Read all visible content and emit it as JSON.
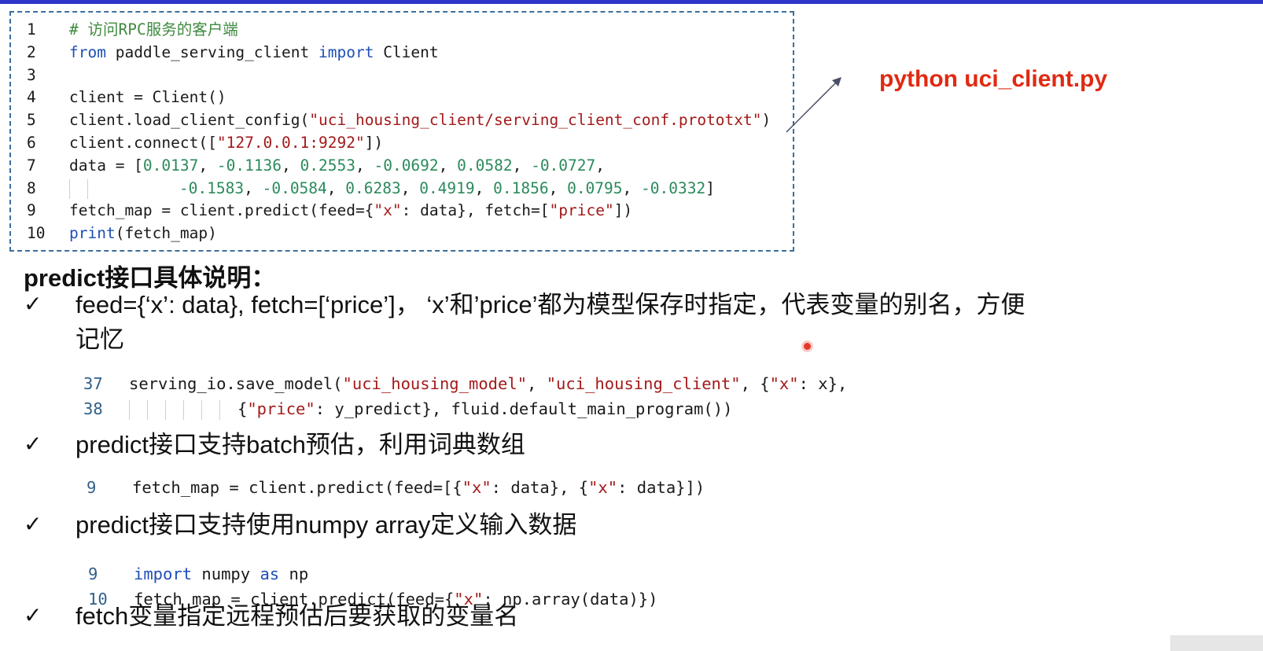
{
  "code_block": {
    "lines": [
      {
        "n": "1",
        "parts": [
          {
            "t": "# 访问RPC服务的客户端",
            "c": "com"
          }
        ]
      },
      {
        "n": "2",
        "parts": [
          {
            "t": "from",
            "c": "kw"
          },
          {
            "t": " paddle_serving_client ",
            "c": ""
          },
          {
            "t": "import",
            "c": "kw"
          },
          {
            "t": " Client",
            "c": ""
          }
        ]
      },
      {
        "n": "3",
        "parts": []
      },
      {
        "n": "4",
        "parts": [
          {
            "t": "client = Client()",
            "c": ""
          }
        ]
      },
      {
        "n": "5",
        "parts": [
          {
            "t": "client.load_client_config(",
            "c": ""
          },
          {
            "t": "\"uci_housing_client/serving_client_conf.prototxt\"",
            "c": "str"
          },
          {
            "t": ")",
            "c": ""
          }
        ]
      },
      {
        "n": "6",
        "parts": [
          {
            "t": "client.connect([",
            "c": ""
          },
          {
            "t": "\"127.0.0.1:9292\"",
            "c": "str"
          },
          {
            "t": "])",
            "c": ""
          }
        ]
      },
      {
        "n": "7",
        "parts": [
          {
            "t": "data = [",
            "c": ""
          },
          {
            "t": "0.0137",
            "c": "num"
          },
          {
            "t": ", ",
            "c": ""
          },
          {
            "t": "-0.1136",
            "c": "num"
          },
          {
            "t": ", ",
            "c": ""
          },
          {
            "t": "0.2553",
            "c": "num"
          },
          {
            "t": ", ",
            "c": ""
          },
          {
            "t": "-0.0692",
            "c": "num"
          },
          {
            "t": ", ",
            "c": ""
          },
          {
            "t": "0.0582",
            "c": "num"
          },
          {
            "t": ", ",
            "c": ""
          },
          {
            "t": "-0.0727",
            "c": "num"
          },
          {
            "t": ",",
            "c": ""
          }
        ]
      },
      {
        "n": "8",
        "guides": 2,
        "parts": [
          {
            "t": "        ",
            "c": ""
          },
          {
            "t": "-0.1583",
            "c": "num"
          },
          {
            "t": ", ",
            "c": ""
          },
          {
            "t": "-0.0584",
            "c": "num"
          },
          {
            "t": ", ",
            "c": ""
          },
          {
            "t": "0.6283",
            "c": "num"
          },
          {
            "t": ", ",
            "c": ""
          },
          {
            "t": "0.4919",
            "c": "num"
          },
          {
            "t": ", ",
            "c": ""
          },
          {
            "t": "0.1856",
            "c": "num"
          },
          {
            "t": ", ",
            "c": ""
          },
          {
            "t": "0.0795",
            "c": "num"
          },
          {
            "t": ", ",
            "c": ""
          },
          {
            "t": "-0.0332",
            "c": "num"
          },
          {
            "t": "]",
            "c": ""
          }
        ]
      },
      {
        "n": "9",
        "parts": [
          {
            "t": "fetch_map = client.predict(feed={",
            "c": ""
          },
          {
            "t": "\"x\"",
            "c": "str"
          },
          {
            "t": ": data}, fetch=[",
            "c": ""
          },
          {
            "t": "\"price\"",
            "c": "str"
          },
          {
            "t": "])",
            "c": ""
          }
        ]
      },
      {
        "n": "10",
        "parts": [
          {
            "t": "print",
            "c": "kw"
          },
          {
            "t": "(fetch_map)",
            "c": ""
          }
        ]
      }
    ]
  },
  "command": "python uci_client.py",
  "heading": "predict接口具体说明：",
  "check_glyph": "✓",
  "bullets": [
    {
      "line1": "feed={‘x’: data}, fetch=[‘price’]， ‘x’和’price’都为模型保存时指定，代表变量的别名，方便",
      "line2": "记忆"
    },
    {
      "line1": "predict接口支持batch预估，利用词典数组"
    },
    {
      "line1": "predict接口支持使用numpy array定义输入数据"
    },
    {
      "line1": "fetch变量指定远程预估后要获取的变量名"
    }
  ],
  "snippets": {
    "save_model": [
      {
        "n": "37",
        "parts": [
          {
            "t": "serving_io.save_model(",
            "c": ""
          },
          {
            "t": "\"uci_housing_model\"",
            "c": "str"
          },
          {
            "t": ", ",
            "c": ""
          },
          {
            "t": "\"uci_housing_client\"",
            "c": "str"
          },
          {
            "t": ", {",
            "c": ""
          },
          {
            "t": "\"x\"",
            "c": "str"
          },
          {
            "t": ": x},",
            "c": ""
          }
        ]
      },
      {
        "n": "38",
        "guides": 6,
        "parts": [
          {
            "t": "{",
            "c": ""
          },
          {
            "t": "\"price\"",
            "c": "str"
          },
          {
            "t": ": y_predict}, fluid.default_main_program())",
            "c": ""
          }
        ]
      }
    ],
    "batch": [
      {
        "n": "9",
        "parts": [
          {
            "t": "fetch_map = client.predict(feed=[{",
            "c": ""
          },
          {
            "t": "\"x\"",
            "c": "str"
          },
          {
            "t": ": data}, {",
            "c": ""
          },
          {
            "t": "\"x\"",
            "c": "str"
          },
          {
            "t": ": data}])",
            "c": ""
          }
        ]
      }
    ],
    "numpy": [
      {
        "n": "9",
        "parts": [
          {
            "t": "import",
            "c": "kw"
          },
          {
            "t": " numpy ",
            "c": ""
          },
          {
            "t": "as",
            "c": "kw"
          },
          {
            "t": " np",
            "c": ""
          }
        ]
      },
      {
        "n": "10",
        "parts": [
          {
            "t": "fetch_map = client.predict(feed={",
            "c": ""
          },
          {
            "t": "\"x\"",
            "c": "str"
          },
          {
            "t": ": np.array(data)})",
            "c": ""
          }
        ]
      }
    ]
  }
}
